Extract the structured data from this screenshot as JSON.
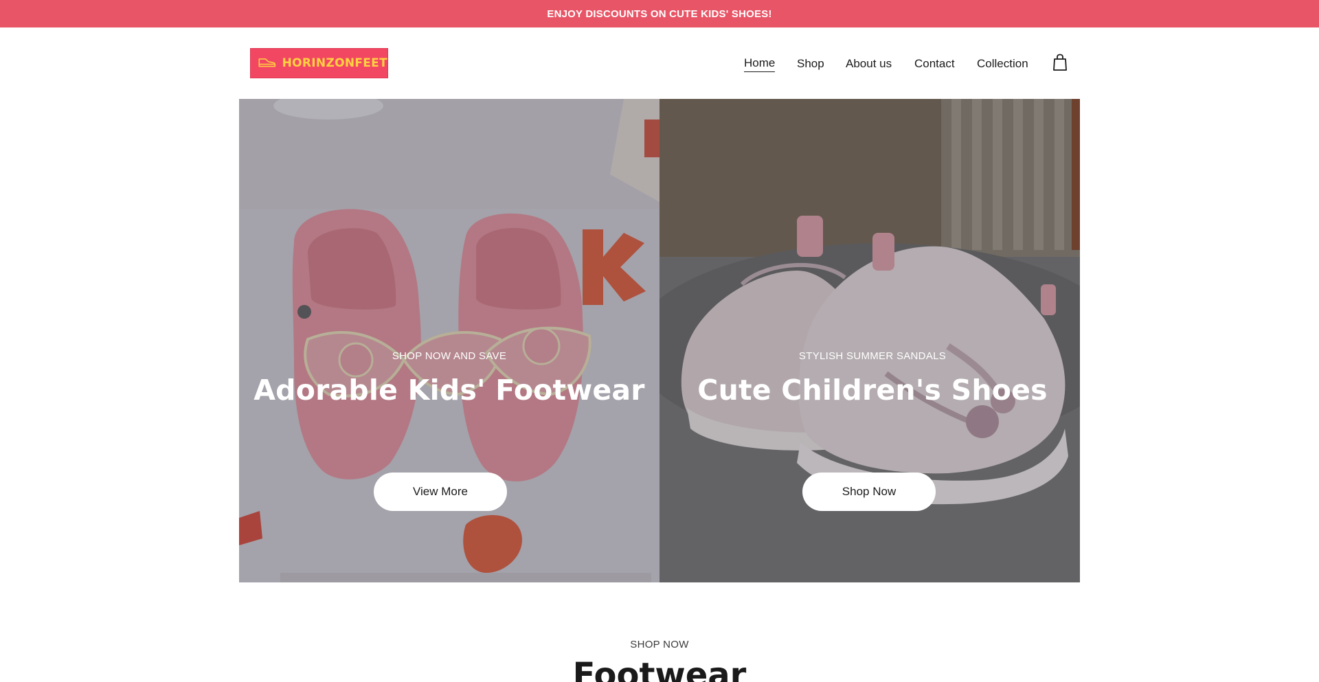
{
  "announcement": {
    "text": "ENJOY DISCOUNTS ON CUTE KIDS' SHOES!"
  },
  "brand": {
    "logo_text": "HORINZONFEET",
    "logo_bg": "#f24763",
    "logo_fg": "#ffd23f"
  },
  "nav": {
    "items": [
      {
        "label": "Home",
        "active": true
      },
      {
        "label": "Shop"
      },
      {
        "label": "About us"
      },
      {
        "label": "Contact"
      },
      {
        "label": "Collection"
      }
    ],
    "cart_icon": "shopping-bag-icon"
  },
  "hero": {
    "left": {
      "subtitle": "SHOP NOW AND SAVE",
      "title": "Adorable Kids' Footwear",
      "button": "View More"
    },
    "right": {
      "subtitle": "STYLISH SUMMER SANDALS",
      "title": "Cute Children's Shoes",
      "button": "Shop Now"
    }
  },
  "section": {
    "subtitle": "SHOP NOW",
    "title": "Footwear"
  },
  "colors": {
    "announcement_bg": "#e85566",
    "text": "#1a1a1a"
  }
}
